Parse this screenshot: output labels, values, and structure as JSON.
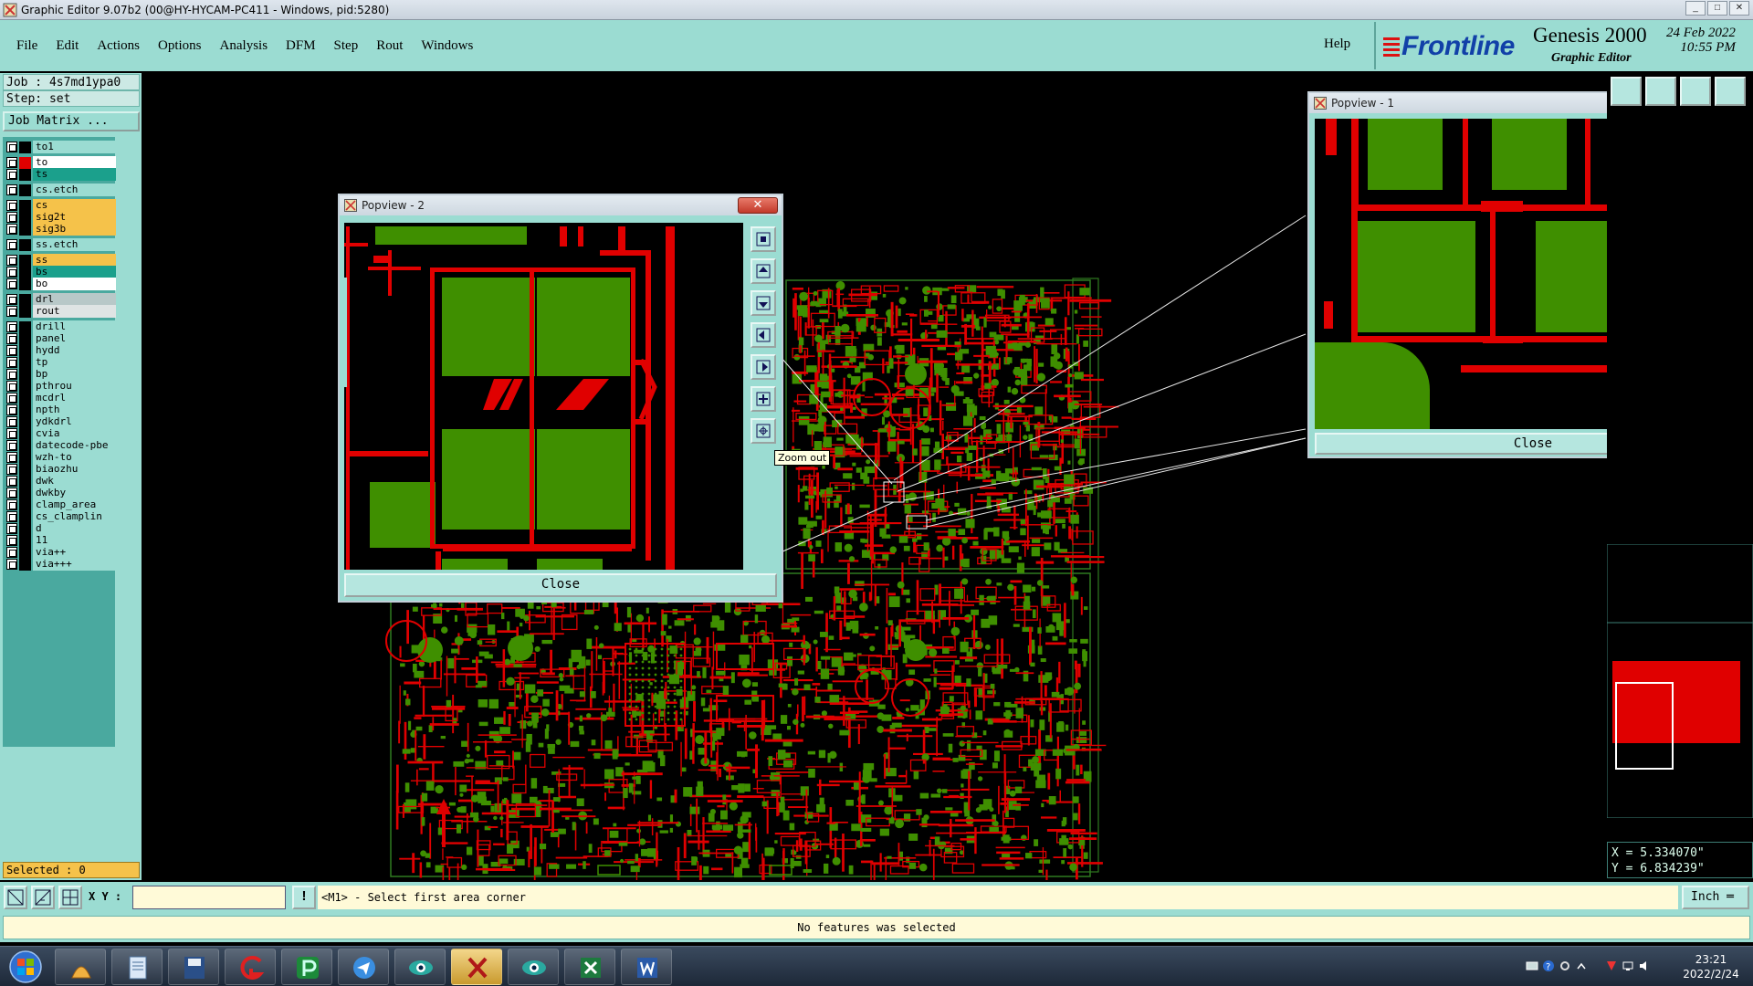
{
  "window": {
    "title": "Graphic Editor 9.07b2 (00@HY-HYCAM-PC411 - Windows, pid:5280)"
  },
  "menu": [
    "File",
    "Edit",
    "Actions",
    "Options",
    "Analysis",
    "DFM",
    "Step",
    "Rout",
    "Windows"
  ],
  "help_label": "Help",
  "brand": {
    "logo": "Frontline",
    "product": "Genesis 2000",
    "subtitle": "Graphic Editor",
    "date": "24 Feb 2022",
    "time": "10:55 PM"
  },
  "job": "Job : 4s7md1ypa0",
  "step": "Step: set",
  "job_matrix": "Job Matrix ...",
  "layers": [
    {
      "name": "to1",
      "color": "#9bdcd2",
      "swatch": "#000000"
    },
    {
      "name": "to",
      "color": "#ffffff",
      "swatch": "#e00000",
      "active": true
    },
    {
      "name": "ts",
      "color": "#1ba08c",
      "swatch": "#000000"
    },
    {
      "name": "cs.etch",
      "color": "#9bdcd2",
      "swatch": "#000000"
    },
    {
      "name": "cs",
      "color": "#f5c24a",
      "swatch": "#000000"
    },
    {
      "name": "sig2t",
      "color": "#f5c24a",
      "swatch": "#000000"
    },
    {
      "name": "sig3b",
      "color": "#f5c24a",
      "swatch": "#000000"
    },
    {
      "name": "ss.etch",
      "color": "#9bdcd2",
      "swatch": "#000000"
    },
    {
      "name": "ss",
      "color": "#f5c24a",
      "swatch": "#000000"
    },
    {
      "name": "bs",
      "color": "#1ba08c",
      "swatch": "#000000"
    },
    {
      "name": "bo",
      "color": "#ffffff",
      "swatch": "#000000"
    },
    {
      "name": "drl",
      "color": "#b8c8c8",
      "swatch": "#000000"
    },
    {
      "name": "rout",
      "color": "#dfe4e4",
      "swatch": "#000000"
    },
    {
      "name": "drill",
      "color": "#9bdcd2",
      "swatch": "#000000"
    },
    {
      "name": "panel",
      "color": "#9bdcd2",
      "swatch": "#000000"
    },
    {
      "name": "hydd",
      "color": "#9bdcd2",
      "swatch": "#000000"
    },
    {
      "name": "tp",
      "color": "#9bdcd2",
      "swatch": "#000000"
    },
    {
      "name": "bp",
      "color": "#9bdcd2",
      "swatch": "#000000"
    },
    {
      "name": "pthrou",
      "color": "#9bdcd2",
      "swatch": "#000000"
    },
    {
      "name": "mcdrl",
      "color": "#9bdcd2",
      "swatch": "#000000"
    },
    {
      "name": "npth",
      "color": "#9bdcd2",
      "swatch": "#000000"
    },
    {
      "name": "ydkdrl",
      "color": "#9bdcd2",
      "swatch": "#000000"
    },
    {
      "name": "cvia",
      "color": "#9bdcd2",
      "swatch": "#000000"
    },
    {
      "name": "datecode-pbe",
      "color": "#9bdcd2",
      "swatch": "#000000"
    },
    {
      "name": "wzh-to",
      "color": "#9bdcd2",
      "swatch": "#000000"
    },
    {
      "name": "biaozhu",
      "color": "#9bdcd2",
      "swatch": "#000000"
    },
    {
      "name": "dwk",
      "color": "#9bdcd2",
      "swatch": "#000000"
    },
    {
      "name": "dwkby",
      "color": "#9bdcd2",
      "swatch": "#000000"
    },
    {
      "name": "clamp_area",
      "color": "#9bdcd2",
      "swatch": "#000000"
    },
    {
      "name": "cs_clamplin",
      "color": "#9bdcd2",
      "swatch": "#000000"
    },
    {
      "name": "d",
      "color": "#9bdcd2",
      "swatch": "#000000"
    },
    {
      "name": "11",
      "color": "#9bdcd2",
      "swatch": "#000000"
    },
    {
      "name": "via++",
      "color": "#9bdcd2",
      "swatch": "#000000"
    },
    {
      "name": "via+++",
      "color": "#9bdcd2",
      "swatch": "#000000"
    }
  ],
  "selected": "Selected : 0",
  "popview1": {
    "title": "Popview - 1",
    "close_label": "Close"
  },
  "popview2": {
    "title": "Popview - 2",
    "close_label": "Close",
    "close_x": "✕"
  },
  "tooltip": "Zoom out",
  "coords": {
    "x": "X = 5.334070\"",
    "y": "Y = 6.834239\""
  },
  "cmd": {
    "xy_label": "X Y :",
    "xy_value": "",
    "prompt_icon": "!",
    "prompt": "<M1> - Select first area corner",
    "unit": "Inch ═"
  },
  "status": "No features was selected",
  "clock": {
    "time": "23:21",
    "date": "2022/2/24"
  },
  "colors": {
    "panel": "#9bdcd2",
    "copper": "#e00000",
    "pad": "#3f8f00",
    "outline": "#2f7a20"
  }
}
